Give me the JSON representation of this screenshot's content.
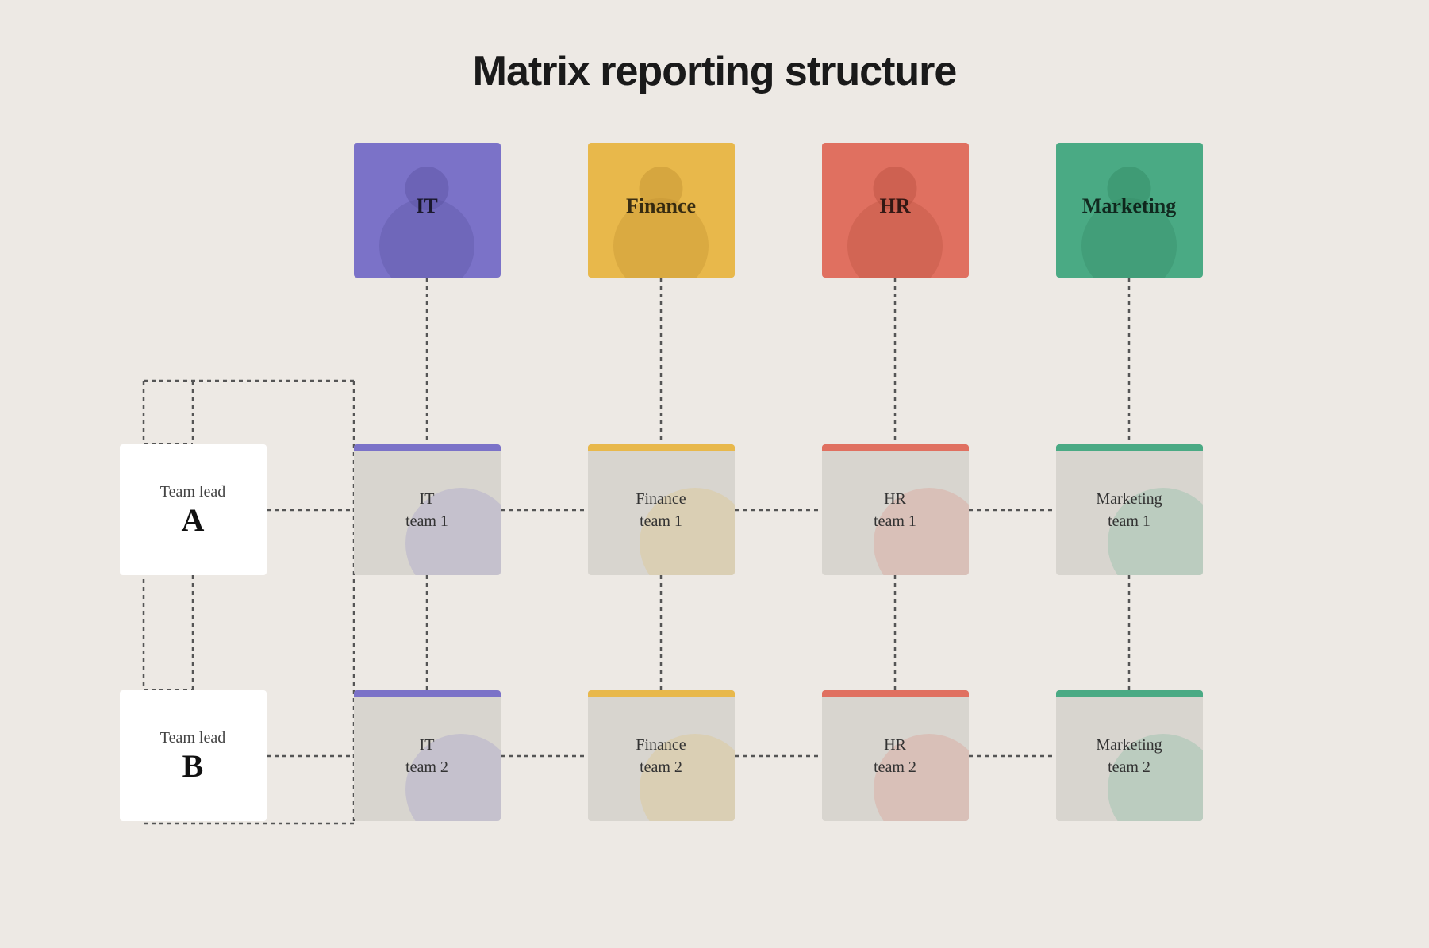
{
  "title": "Matrix reporting structure",
  "departments": [
    {
      "id": "it",
      "label": "IT"
    },
    {
      "id": "finance",
      "label": "Finance"
    },
    {
      "id": "hr",
      "label": "HR"
    },
    {
      "id": "marketing",
      "label": "Marketing"
    }
  ],
  "teamLeads": [
    {
      "id": "lead-a",
      "label": "Team lead",
      "letter": "A"
    },
    {
      "id": "lead-b",
      "label": "Team lead",
      "letter": "B"
    }
  ],
  "teams": {
    "row1": [
      {
        "id": "it-team-1",
        "line1": "IT",
        "line2": "team 1"
      },
      {
        "id": "finance-team-1",
        "line1": "Finance",
        "line2": "team 1"
      },
      {
        "id": "hr-team-1",
        "line1": "HR",
        "line2": "team 1"
      },
      {
        "id": "marketing-team-1",
        "line1": "Marketing",
        "line2": "team 1"
      }
    ],
    "row2": [
      {
        "id": "it-team-2",
        "line1": "IT",
        "line2": "team 2"
      },
      {
        "id": "finance-team-2",
        "line1": "Finance",
        "line2": "team 2"
      },
      {
        "id": "hr-team-2",
        "line1": "HR",
        "line2": "team 2"
      },
      {
        "id": "marketing-team-2",
        "line1": "Marketing",
        "line2": "team 2"
      }
    ]
  }
}
